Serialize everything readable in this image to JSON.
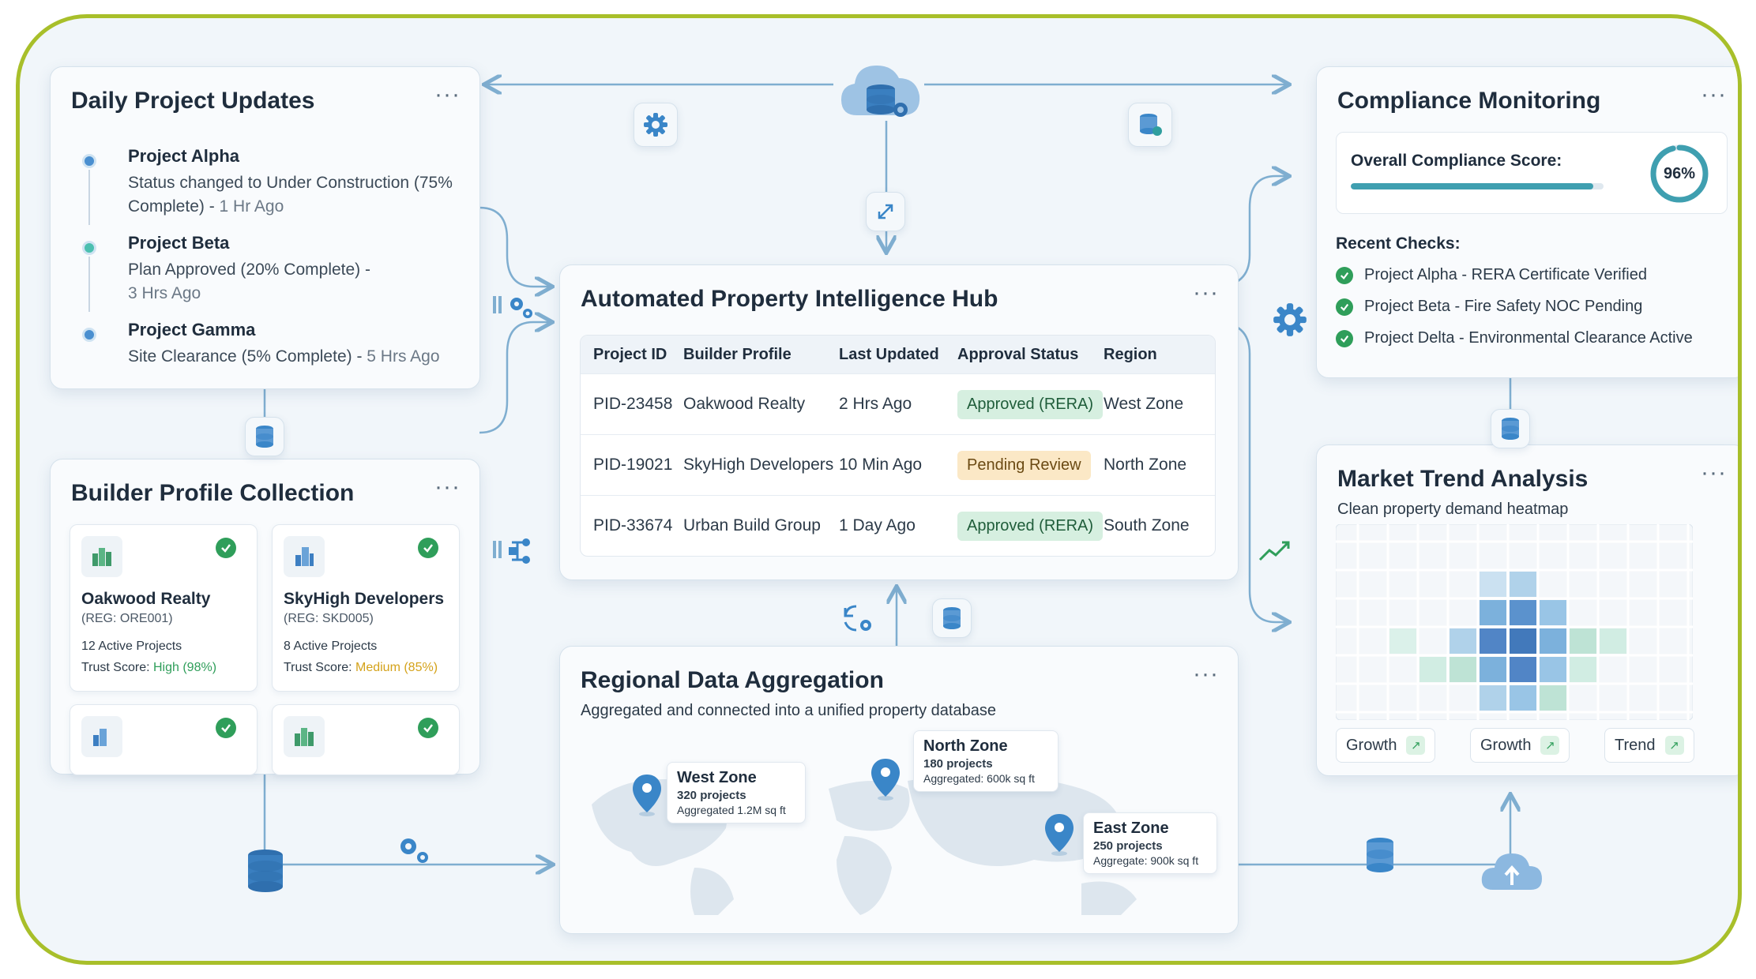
{
  "daily_updates": {
    "title": "Daily Project Updates",
    "more": "···",
    "items": [
      {
        "name": "Project Alpha",
        "desc": "Status changed to Under Construction (75% Complete) -",
        "ago": "1 Hr Ago",
        "dot_color": "#4a8fd0"
      },
      {
        "name": "Project Beta",
        "desc": "Plan Approved (20% Complete) -",
        "ago": "3 Hrs Ago",
        "dot_color": "#4bbfb0"
      },
      {
        "name": "Project Gamma",
        "desc": "Site Clearance (5% Complete) -",
        "ago": "5 Hrs Ago",
        "dot_color": "#4a8fd0"
      }
    ]
  },
  "hub": {
    "title": "Automated Property Intelligence Hub",
    "more": "···",
    "columns": [
      "Project ID",
      "Builder Profile",
      "Last Updated",
      "Approval Status",
      "Region"
    ],
    "rows": [
      {
        "id": "PID-23458",
        "builder": "Oakwood Realty",
        "updated": "2 Hrs Ago",
        "status": "Approved (RERA)",
        "status_kind": "approved",
        "region": "West Zone"
      },
      {
        "id": "PID-19021",
        "builder": "SkyHigh Developers",
        "updated": "10 Min Ago",
        "status": "Pending Review",
        "status_kind": "pending",
        "region": "North Zone"
      },
      {
        "id": "PID-33674",
        "builder": "Urban Build Group",
        "updated": "1 Day Ago",
        "status": "Approved (RERA)",
        "status_kind": "approved",
        "region": "South Zone"
      }
    ]
  },
  "builders": {
    "title": "Builder Profile Collection",
    "more": "···",
    "cards": [
      {
        "name": "Oakwood Realty",
        "reg": "(REG: ORE001)",
        "projects": "12 Active Projects",
        "trust_label": "Trust Score: ",
        "trust_value": "High (98%)",
        "trust_kind": "high"
      },
      {
        "name": "SkyHigh Developers",
        "reg": "(REG: SKD005)",
        "projects": "8 Active Projects",
        "trust_label": "Trust Score: ",
        "trust_value": "Medium (85%)",
        "trust_kind": "medium"
      },
      {
        "name": "",
        "reg": "",
        "projects": "",
        "trust_label": "",
        "trust_value": "",
        "trust_kind": ""
      },
      {
        "name": "",
        "reg": "",
        "projects": "",
        "trust_label": "",
        "trust_value": "",
        "trust_kind": ""
      }
    ]
  },
  "compliance": {
    "title": "Compliance Monitoring",
    "more": "···",
    "score_label": "Overall Compliance Score:",
    "score_text": "96%",
    "score_value": 0.96,
    "checks_title": "Recent Checks:",
    "checks": [
      "Project Alpha - RERA Certificate Verified",
      "Project Beta - Fire Safety NOC Pending",
      "Project Delta - Environmental Clearance Active"
    ]
  },
  "regional": {
    "title": "Regional Data Aggregation",
    "more": "···",
    "subtitle": "Aggregated and connected into a unified property database",
    "zones": [
      {
        "name": "West Zone",
        "projects": "320 projects",
        "agg": "Aggregated 1.2M sq ft"
      },
      {
        "name": "North Zone",
        "projects": "180 projects",
        "agg": "Aggregated: 600k sq ft"
      },
      {
        "name": "East Zone",
        "projects": "250 projects",
        "agg": "Aggregate: 900k sq ft"
      }
    ]
  },
  "market": {
    "title": "Market Trend Analysis",
    "more": "···",
    "subtitle": "Clean property demand heatmap",
    "buttons": [
      "Growth",
      "Growth",
      "Trend"
    ],
    "button_arrow": "↗"
  },
  "colors": {
    "accent": "#3f8fc6",
    "success": "#2f9e5a",
    "warning": "#d4a21a",
    "frame": "#a8bf2a"
  },
  "icons": [
    "cloud-database-icon",
    "gear-icon",
    "database-icon",
    "expand-arrows-icon",
    "upload-cloud-icon",
    "trend-up-icon",
    "sync-icon",
    "building-icon",
    "check-icon",
    "map-pin-icon"
  ]
}
